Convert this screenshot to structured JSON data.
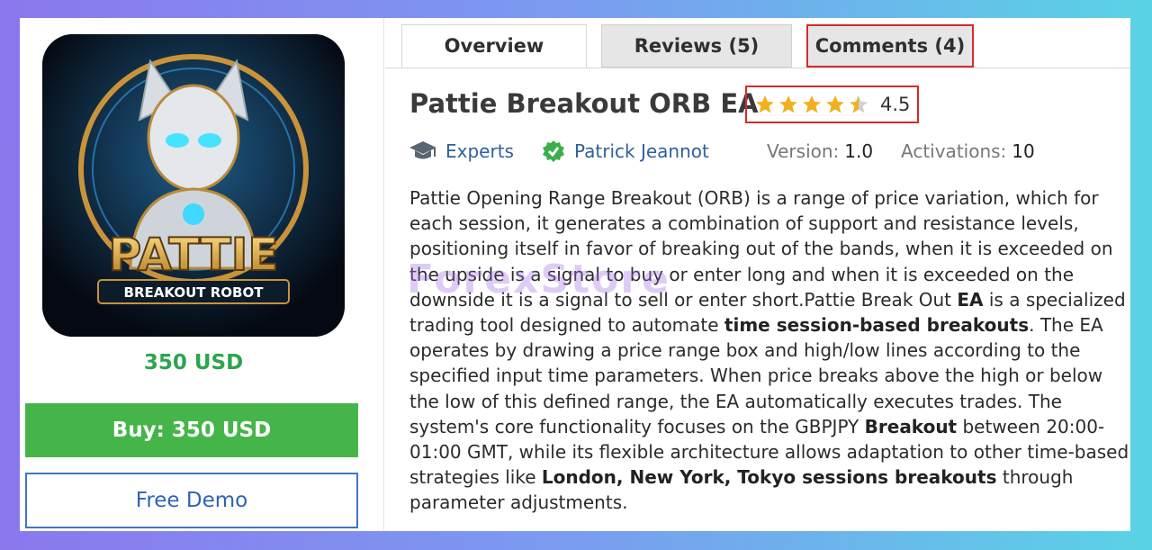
{
  "product": {
    "price_label": "350 USD",
    "buy_label": "Buy: 350 USD",
    "demo_label": "Free Demo",
    "image_title": "PATTIE",
    "image_subtitle": "BREAKOUT ROBOT"
  },
  "tabs": [
    {
      "label": "Overview",
      "active": true
    },
    {
      "label": "Reviews (5)",
      "active": false
    },
    {
      "label": "Comments (4)",
      "active": false
    }
  ],
  "title": "Pattie Breakout ORB EA",
  "rating": {
    "value": 4.5,
    "label": "4.5",
    "max": 5,
    "star_color": "#f2b01e"
  },
  "meta": {
    "category": "Experts",
    "author": "Patrick Jeannot",
    "version_key": "Version:",
    "version_value": "1.0",
    "activations_key": "Activations:",
    "activations_value": "10",
    "category_icon": "graduation-cap-icon",
    "author_icon": "verified-shield-icon"
  },
  "description": {
    "p1": "Pattie Opening Range Breakout (ORB) is a range of price variation, which for each session, it generates a combination of support and resistance levels, positioning itself in favor of breaking out of the bands, when it is exceeded on the upside is a signal to buy or enter long and when it is exceeded on the downside it is a signal to sell or enter short.Pattie Break Out ",
    "b1": "EA",
    "p2": " is a specialized trading tool designed to automate ",
    "b2": "time session-based breakouts",
    "p3": ". The EA operates by drawing a price range box and high/low lines according to the specified input time parameters. When price breaks above the high or below the low of this defined range, the EA automatically executes trades. The system's core functionality focuses on the GBPJPY ",
    "b3": "Breakout",
    "p4": " between 20:00-01:00 GMT, while its flexible architecture allows adaptation to other time-based strategies like ",
    "b4": "London, New York, Tokyo sessions breakouts",
    "p5": " through parameter adjustments."
  },
  "watermark": "ForexStore",
  "colors": {
    "buy_green": "#46b549",
    "price_green": "#2ea44f",
    "link_blue": "#2f5f9f",
    "highlight_red": "#d22c2c"
  }
}
